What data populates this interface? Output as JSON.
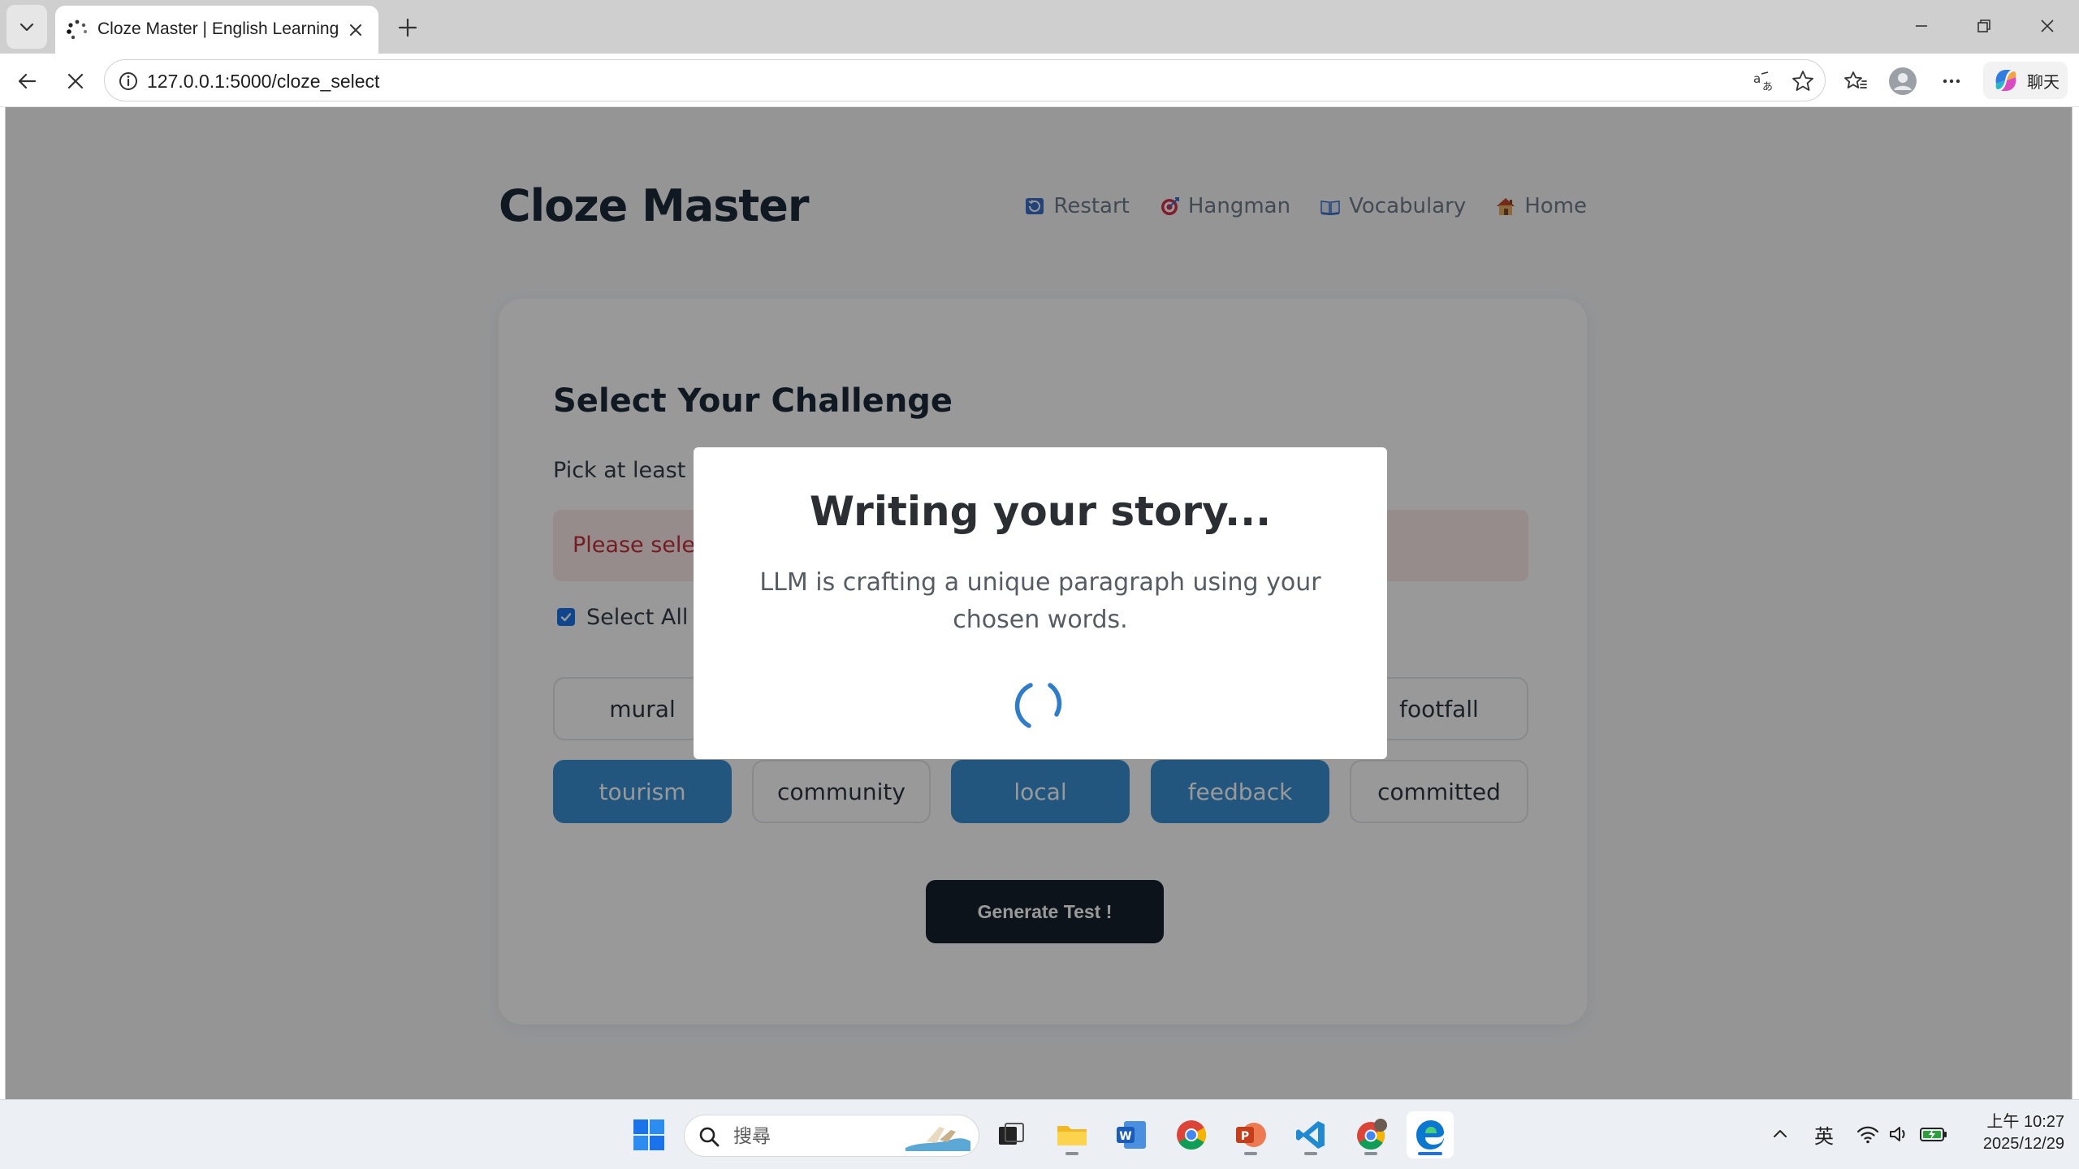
{
  "browser": {
    "tab_title": "Cloze Master | English Learning",
    "url": "127.0.0.1:5000/cloze_select",
    "copilot_label": "聊天"
  },
  "page": {
    "brand": "Cloze Master",
    "nav": [
      {
        "label": "Restart",
        "icon": "restart-icon"
      },
      {
        "label": "Hangman",
        "icon": "target-icon"
      },
      {
        "label": "Vocabulary",
        "icon": "book-icon"
      },
      {
        "label": "Home",
        "icon": "house-icon"
      }
    ],
    "card": {
      "title": "Select Your Challenge",
      "subtitle": "Pick at least 2",
      "alert": "Please sele",
      "select_all_label": "Select All",
      "select_all_checked": true,
      "chips_row1": [
        "mural",
        "footfall"
      ],
      "chips_row2": [
        {
          "label": "tourism",
          "selected": true
        },
        {
          "label": "community",
          "selected": false
        },
        {
          "label": "local",
          "selected": true
        },
        {
          "label": "feedback",
          "selected": true
        },
        {
          "label": "committed",
          "selected": false
        }
      ],
      "generate_label": "Generate Test !"
    },
    "modal": {
      "title": "Writing your story...",
      "text": "LLM is crafting a unique paragraph using your chosen words."
    }
  },
  "taskbar": {
    "search_placeholder": "搜尋",
    "tray_language": "英",
    "clock_time": "上午 10:27",
    "clock_date": "2025/12/29"
  },
  "colors": {
    "accent": "#3a8fd3",
    "brand_dark": "#1b2a3a",
    "alert_text": "#c2303a",
    "alert_bg": "#fbe9ea",
    "button_dark": "#16202c"
  }
}
